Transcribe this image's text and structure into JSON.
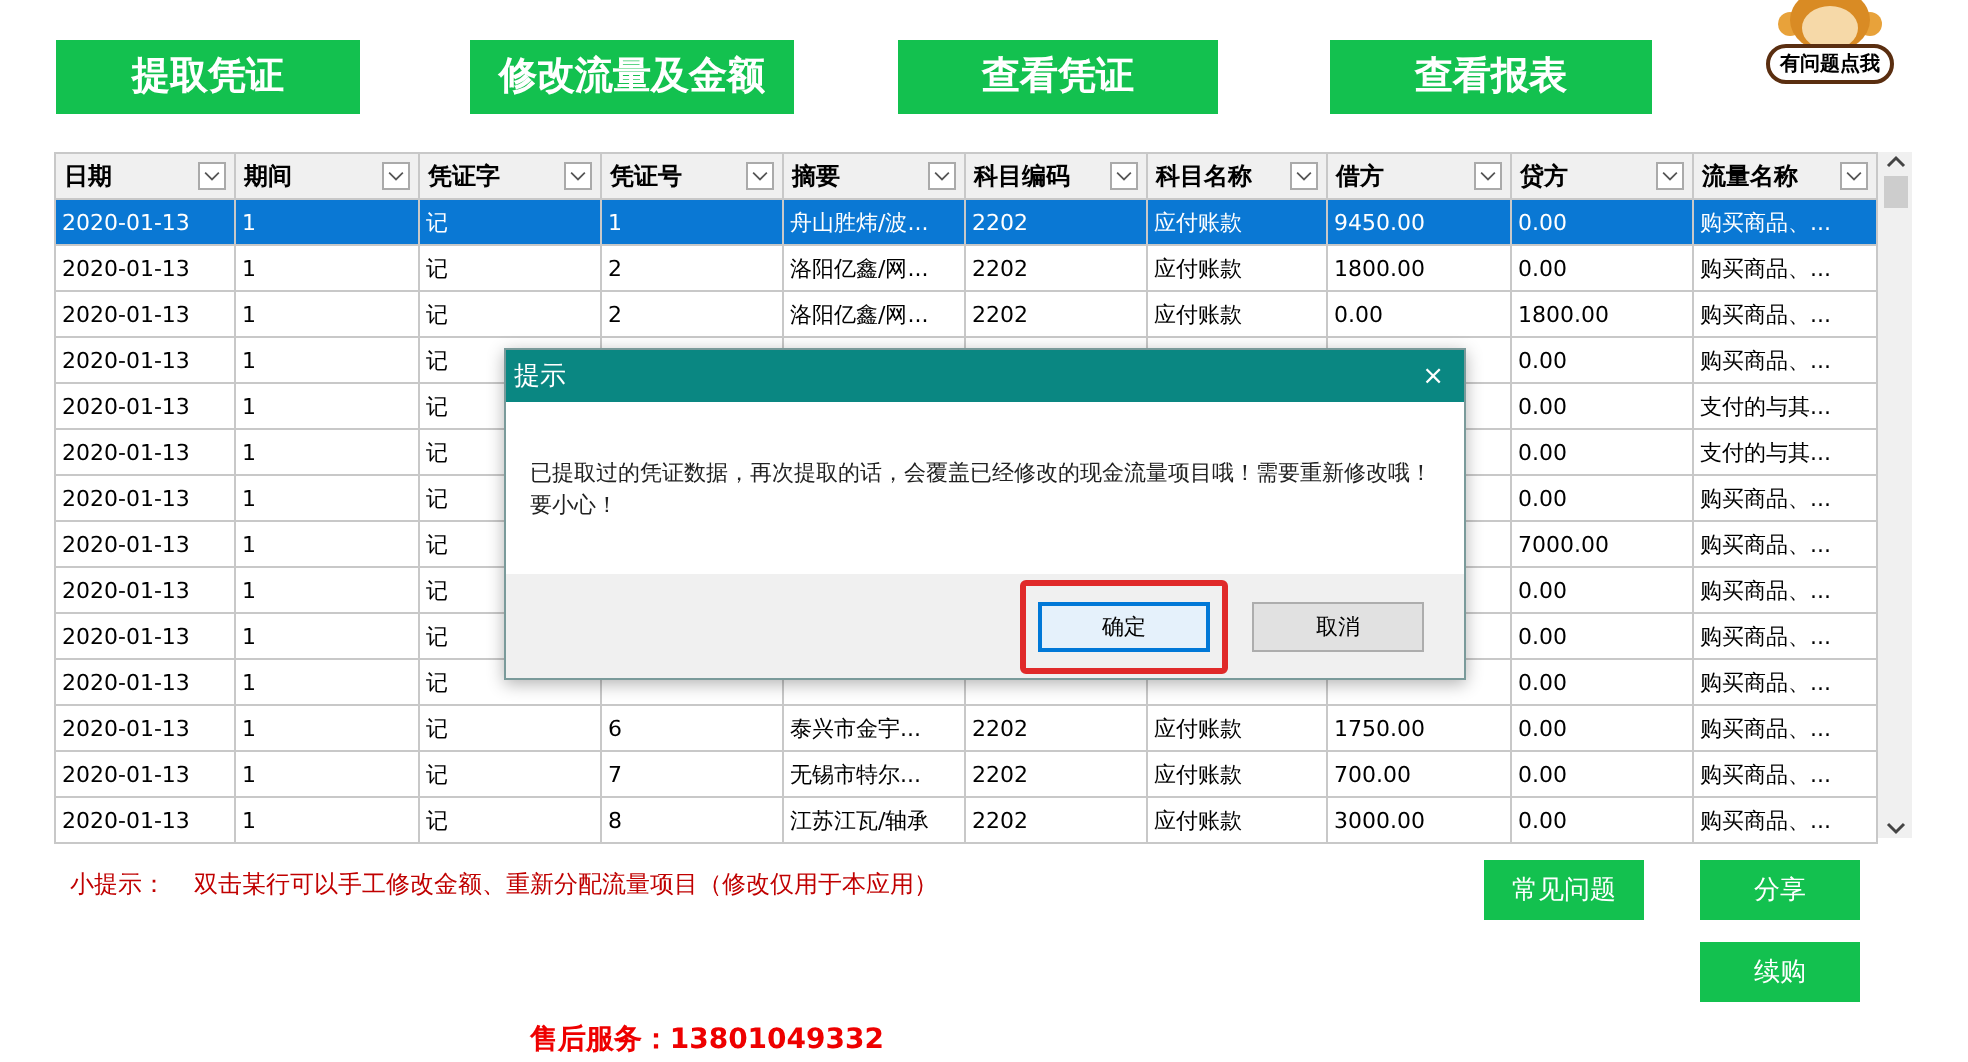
{
  "toolbar": {
    "buttons": [
      "提取凭证",
      "修改流量及金额",
      "查看凭证",
      "查看报表"
    ]
  },
  "help": {
    "label": "有问题点我"
  },
  "table": {
    "columns": [
      "日期",
      "期间",
      "凭证字",
      "凭证号",
      "摘要",
      "科目编码",
      "科目名称",
      "借方",
      "贷方",
      "流量名称"
    ],
    "rows": [
      {
        "selected": true,
        "cells": [
          "2020-01-13",
          "1",
          "记",
          "1",
          "舟山胜炜/波...",
          "2202",
          "应付账款",
          "9450.00",
          "0.00",
          "购买商品、..."
        ]
      },
      {
        "selected": false,
        "cells": [
          "2020-01-13",
          "1",
          "记",
          "2",
          "洛阳亿鑫/网...",
          "2202",
          "应付账款",
          "1800.00",
          "0.00",
          "购买商品、..."
        ]
      },
      {
        "selected": false,
        "cells": [
          "2020-01-13",
          "1",
          "记",
          "2",
          "洛阳亿鑫/网...",
          "2202",
          "应付账款",
          "0.00",
          "1800.00",
          "购买商品、..."
        ]
      },
      {
        "selected": false,
        "cells": [
          "2020-01-13",
          "1",
          "记",
          null,
          null,
          null,
          null,
          null,
          "0.00",
          "购买商品、..."
        ]
      },
      {
        "selected": false,
        "cells": [
          "2020-01-13",
          "1",
          "记",
          null,
          null,
          null,
          null,
          null,
          "0.00",
          "支付的与其..."
        ]
      },
      {
        "selected": false,
        "cells": [
          "2020-01-13",
          "1",
          "记",
          null,
          null,
          null,
          null,
          null,
          "0.00",
          "支付的与其..."
        ]
      },
      {
        "selected": false,
        "cells": [
          "2020-01-13",
          "1",
          "记",
          null,
          null,
          null,
          null,
          null,
          "0.00",
          "购买商品、..."
        ]
      },
      {
        "selected": false,
        "cells": [
          "2020-01-13",
          "1",
          "记",
          null,
          null,
          null,
          null,
          null,
          "7000.00",
          "购买商品、..."
        ]
      },
      {
        "selected": false,
        "cells": [
          "2020-01-13",
          "1",
          "记",
          null,
          null,
          null,
          null,
          null,
          "0.00",
          "购买商品、..."
        ]
      },
      {
        "selected": false,
        "cells": [
          "2020-01-13",
          "1",
          "记",
          null,
          null,
          null,
          null,
          null,
          "0.00",
          "购买商品、..."
        ]
      },
      {
        "selected": false,
        "cells": [
          "2020-01-13",
          "1",
          "记",
          null,
          null,
          null,
          null,
          null,
          "0.00",
          "购买商品、..."
        ]
      },
      {
        "selected": false,
        "cells": [
          "2020-01-13",
          "1",
          "记",
          "6",
          "泰兴市金宇...",
          "2202",
          "应付账款",
          "1750.00",
          "0.00",
          "购买商品、..."
        ]
      },
      {
        "selected": false,
        "cells": [
          "2020-01-13",
          "1",
          "记",
          "7",
          "无锡市特尔...",
          "2202",
          "应付账款",
          "700.00",
          "0.00",
          "购买商品、..."
        ]
      },
      {
        "selected": false,
        "cells": [
          "2020-01-13",
          "1",
          "记",
          "8",
          "江苏江瓦/轴承",
          "2202",
          "应付账款",
          "3000.00",
          "0.00",
          "购买商品、..."
        ]
      }
    ]
  },
  "tip": {
    "label": "小提示：",
    "text": "双击某行可以手工修改金额、重新分配流量项目（修改仅用于本应用）"
  },
  "side_buttons": [
    "常见问题",
    "分享",
    "续购"
  ],
  "service": "售后服务：13801049332",
  "dialog": {
    "title": "提示",
    "close": "×",
    "message": "已提取过的凭证数据，再次提取的话，会覆盖已经修改的现金流量项目哦！需要重新修改哦！要小心！",
    "buttons": [
      {
        "label": "确定",
        "highlighted": true
      },
      {
        "label": "取消",
        "highlighted": false
      }
    ]
  }
}
